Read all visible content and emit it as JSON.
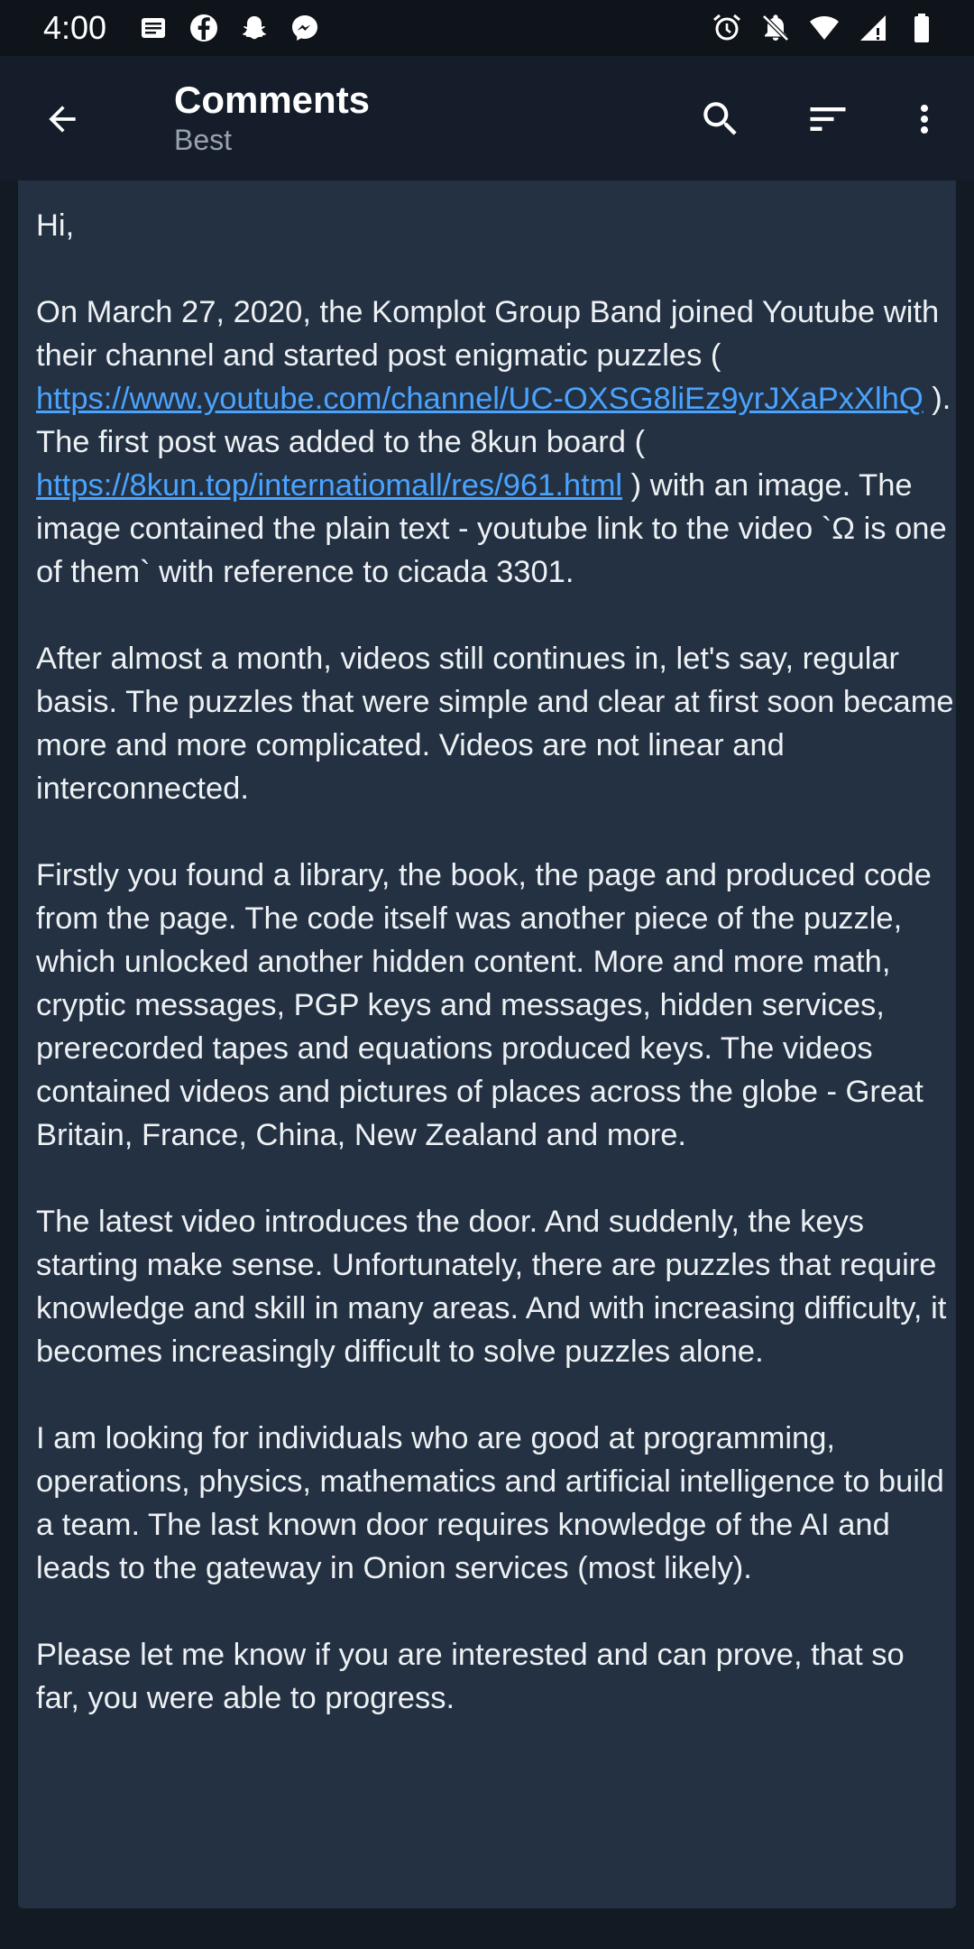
{
  "status_bar": {
    "time": "4:00",
    "left_icons": [
      "news-icon",
      "facebook-icon",
      "snapchat-icon",
      "messenger-icon"
    ],
    "right_icons": [
      "alarm-icon",
      "notifications-off-icon",
      "wifi-icon",
      "signal-icon",
      "battery-icon"
    ]
  },
  "app_bar": {
    "title": "Comments",
    "subtitle": "Best",
    "icons": [
      "back-arrow-icon",
      "search-icon",
      "sort-icon",
      "more-vert-icon"
    ]
  },
  "comment": {
    "greeting": "Hi,",
    "p1_a": "On March 27, 2020, the Komplot Group Band joined Youtube with their channel and started post enigmatic puzzles ( ",
    "link1": "https://www.youtube.com/channel/UC-OXSG8liEz9yrJXaPxXlhQ",
    "p1_b": " ). The first post was added to the 8kun board ( ",
    "link2": "https://8kun.top/internatiomall/res/961.html",
    "p1_c": " ) with an image. The image contained the plain text - youtube link to the video `Ω is one of them` with reference to cicada 3301.",
    "p2": "After almost a month, videos still continues in, let's say, regular basis. The puzzles that were simple and clear at first soon became more and more complicated. Videos are not linear and interconnected.",
    "p3": "Firstly you found a library, the book, the page and produced code from the page. The code itself was another piece of the puzzle, which unlocked another hidden content. More and more math, cryptic messages, PGP keys and messages, hidden services, prerecorded tapes and equations produced keys. The videos contained videos and pictures of places across the globe - Great Britain, France, China, New Zealand and more.",
    "p4": "The latest video introduces the door. And suddenly, the keys starting make sense. Unfortunately, there are puzzles that require knowledge and skill in many areas. And with increasing difficulty, it becomes increasingly difficult to solve puzzles alone.",
    "p5": "I am looking for individuals who are good at programming, operations, physics, mathematics and artificial intelligence to build a team. The last known door requires knowledge of the AI and leads to the gateway in Onion services (most likely).",
    "p6": "Please let me know if you are interested and can prove, that so far, you were able to progress."
  },
  "colors": {
    "app_bar_bg": "#141d29",
    "card_bg": "#233142",
    "link": "#4aa3ff",
    "text": "#eef1f4"
  }
}
